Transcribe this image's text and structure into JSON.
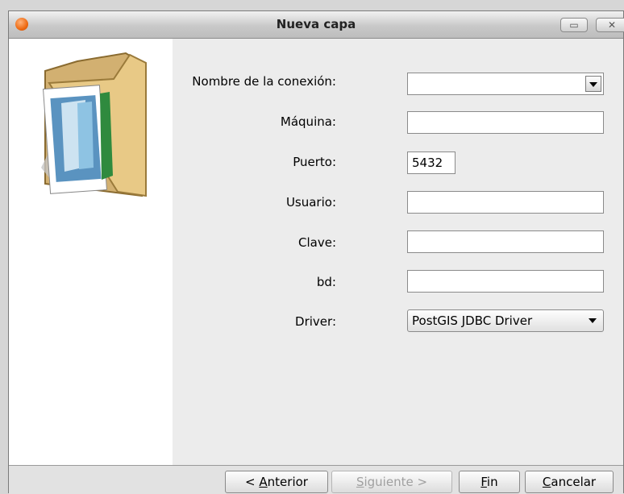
{
  "window": {
    "title": "Nueva capa"
  },
  "form": {
    "connection_label": "Nombre de la conexión:",
    "connection_value": "",
    "machine_label": "Máquina:",
    "machine_value": "",
    "port_label": "Puerto:",
    "port_value": "5432",
    "user_label": "Usuario:",
    "user_value": "",
    "password_label": "Clave:",
    "password_value": "",
    "db_label": "bd:",
    "db_value": "",
    "driver_label": "Driver:",
    "driver_value": "PostGIS JDBC Driver"
  },
  "buttons": {
    "prev_prefix": "< ",
    "prev_mnemonic": "A",
    "prev_rest": "nterior",
    "next_mnemonic": "S",
    "next_rest": "iguiente >",
    "finish_mnemonic": "F",
    "finish_rest": "in",
    "cancel_mnemonic": "C",
    "cancel_rest": "ancelar"
  },
  "icons": {
    "app": "app-icon",
    "folder": "folder-images-icon",
    "minimize": "minimize-icon",
    "close": "close-icon",
    "dropdown": "chevron-down-icon"
  }
}
